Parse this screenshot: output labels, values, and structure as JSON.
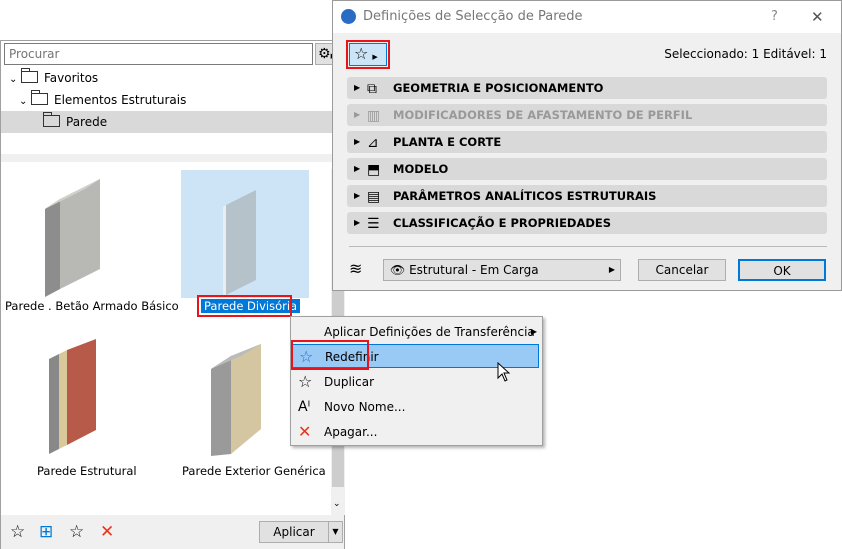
{
  "left_panel": {
    "search_placeholder": "Procurar",
    "tree": [
      {
        "label": "Favoritos"
      },
      {
        "label": "Elementos Estruturais"
      },
      {
        "label": "Parede"
      }
    ],
    "items": [
      {
        "label": "Parede . Betão Armado Básico"
      },
      {
        "label": "Parede Divisória"
      },
      {
        "label": "Parede Estrutural"
      },
      {
        "label": "Parede Exterior Genérica"
      }
    ],
    "apply_label": "Aplicar"
  },
  "dialog": {
    "title": "Definições de Selecção de Parede",
    "help": "?",
    "close": "✕",
    "selection_info": "Seleccionado: 1 Editável: 1",
    "sections": [
      {
        "label": "GEOMETRIA E POSICIONAMENTO",
        "enabled": true
      },
      {
        "label": "MODIFICADORES DE AFASTAMENTO DE PERFIL",
        "enabled": false
      },
      {
        "label": "PLANTA E CORTE",
        "enabled": true
      },
      {
        "label": "MODELO",
        "enabled": true
      },
      {
        "label": "PARÂMETROS ANALÍTICOS ESTRUTURAIS",
        "enabled": true
      },
      {
        "label": "CLASSIFICAÇÃO E PROPRIEDADES",
        "enabled": true
      }
    ],
    "layer": "Estrutural - Em Carga",
    "cancel": "Cancelar",
    "ok": "OK"
  },
  "context_menu": {
    "items": [
      {
        "label": "Aplicar Definições de Transferência"
      },
      {
        "label": "Redefinir"
      },
      {
        "label": "Duplicar"
      },
      {
        "label": "Novo Nome..."
      },
      {
        "label": "Apagar..."
      }
    ]
  },
  "colors": {
    "accent": "#0078d7",
    "highlight": "#99c9f5",
    "annotation": "#e8141b",
    "delete": "#e8341b"
  }
}
